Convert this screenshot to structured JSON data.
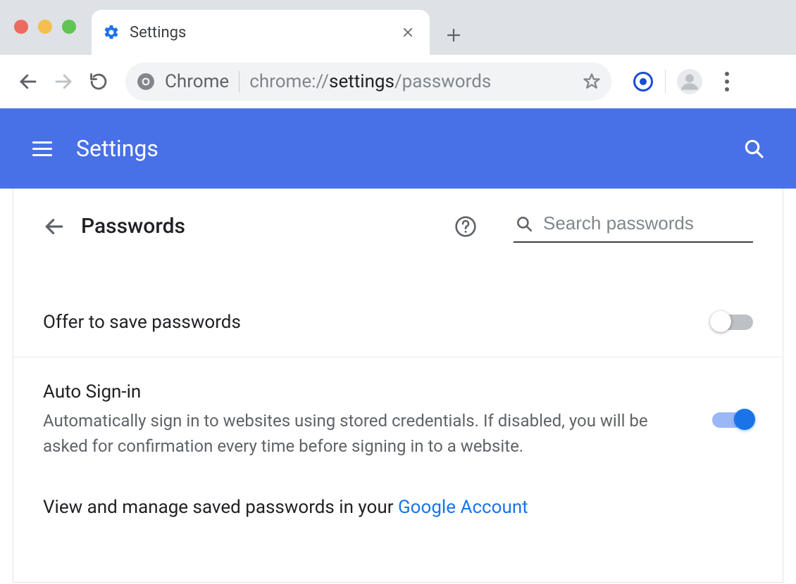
{
  "tab": {
    "title": "Settings"
  },
  "omnibox": {
    "scheme_label": "Chrome",
    "url_prefix": "chrome://",
    "url_bold": "settings",
    "url_suffix": "/passwords"
  },
  "header": {
    "title": "Settings"
  },
  "page": {
    "title": "Passwords",
    "search_placeholder": "Search passwords"
  },
  "rows": {
    "offer_save": {
      "title": "Offer to save passwords",
      "on": false
    },
    "auto_signin": {
      "title": "Auto Sign-in",
      "desc": "Automatically sign in to websites using stored credentials. If disabled, you will be asked for confirmation every time before signing in to a website.",
      "on": true
    }
  },
  "link_row": {
    "prefix": "View and manage saved passwords in your ",
    "link_text": "Google Account"
  }
}
